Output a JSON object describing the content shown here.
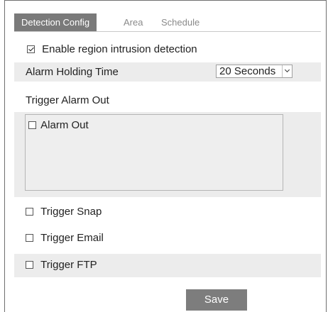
{
  "tabs": [
    {
      "label": "Detection Config",
      "active": true
    },
    {
      "label": "Area",
      "active": false
    },
    {
      "label": "Schedule",
      "active": false
    }
  ],
  "enable": {
    "label": "Enable region intrusion detection",
    "checked": true
  },
  "alarm_holding": {
    "label": "Alarm Holding Time",
    "value": "20 Seconds"
  },
  "trigger_alarm_out": {
    "label": "Trigger Alarm Out",
    "items": [
      {
        "label": "Alarm Out",
        "checked": false
      }
    ]
  },
  "trigger_snap": {
    "label": "Trigger Snap",
    "checked": false
  },
  "trigger_email": {
    "label": "Trigger Email",
    "checked": false
  },
  "trigger_ftp": {
    "label": "Trigger FTP",
    "checked": false
  },
  "save_label": "Save",
  "colors": {
    "tab_active_bg": "#7a7a7a",
    "button_bg": "#7d7d7d",
    "shaded_row": "#ececec"
  }
}
